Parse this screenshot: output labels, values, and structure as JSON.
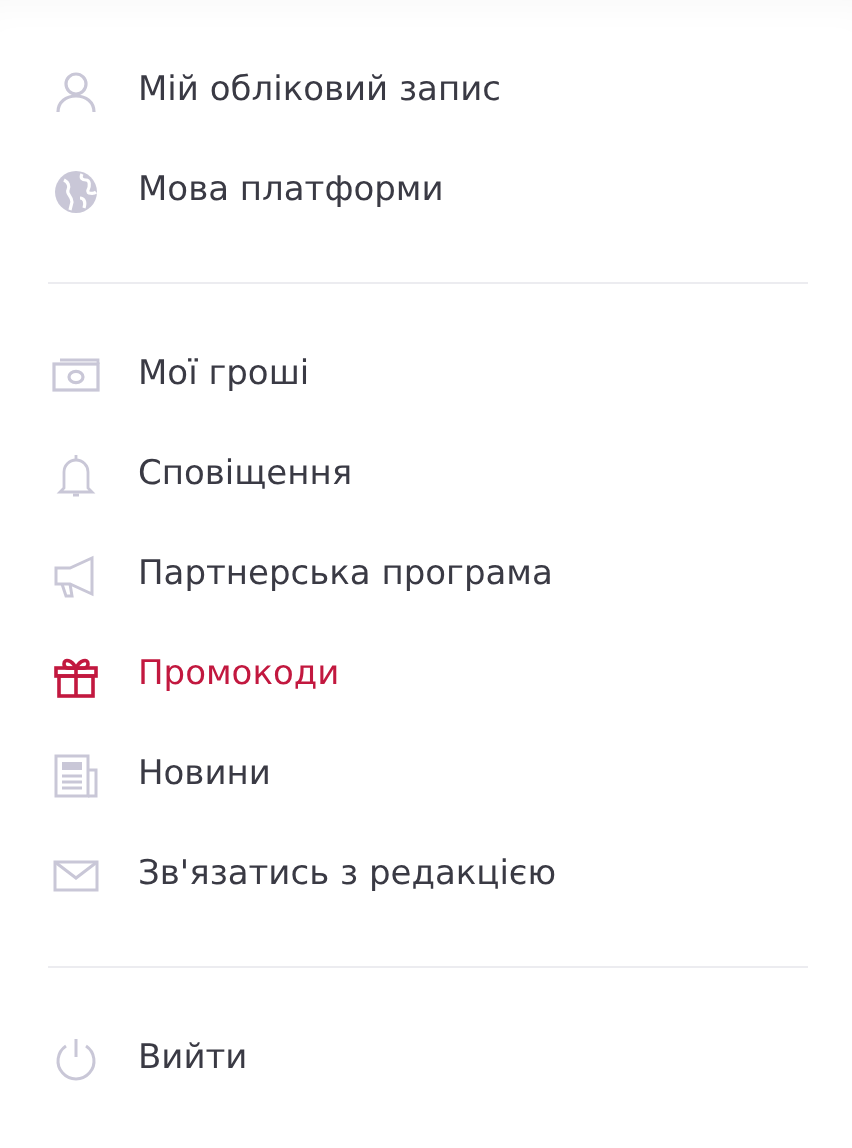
{
  "menu_sections": [
    {
      "items": [
        {
          "label": "Мій обліковий запис",
          "kind": "user",
          "selected": false
        },
        {
          "label": "Мова платформи",
          "kind": "globe",
          "selected": false
        }
      ]
    },
    {
      "items": [
        {
          "label": "Мої гроші",
          "kind": "money",
          "selected": false
        },
        {
          "label": "Сповіщення",
          "kind": "bell",
          "selected": false
        },
        {
          "label": "Партнерська програма",
          "kind": "megaphone",
          "selected": false
        },
        {
          "label": "Промокоди",
          "kind": "gift",
          "selected": true
        },
        {
          "label": "Новини",
          "kind": "news",
          "selected": false
        },
        {
          "label": "Зв'язатись з редакцією",
          "kind": "mail",
          "selected": false
        }
      ]
    },
    {
      "items": [
        {
          "label": "Вийти",
          "kind": "power",
          "selected": false
        }
      ]
    }
  ]
}
